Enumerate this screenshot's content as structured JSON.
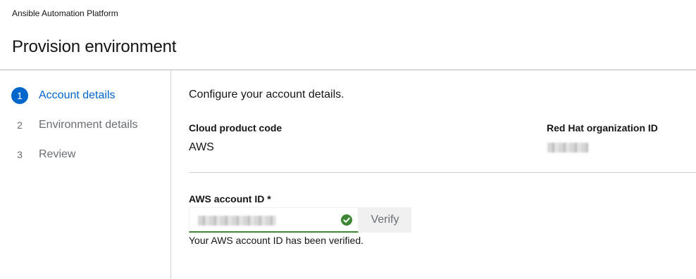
{
  "app": {
    "name": "Ansible Automation Platform"
  },
  "page": {
    "title": "Provision environment"
  },
  "wizard": {
    "steps": [
      {
        "number": "1",
        "label": "Account details",
        "current": true
      },
      {
        "number": "2",
        "label": "Environment details",
        "current": false
      },
      {
        "number": "3",
        "label": "Review",
        "current": false
      }
    ]
  },
  "main": {
    "section_title": "Configure your account details.",
    "cloud_product_code": {
      "label": "Cloud product code",
      "value": "AWS"
    },
    "org_id": {
      "label": "Red Hat organization ID"
    },
    "aws_account": {
      "label": "AWS account ID *",
      "verify_label": "Verify",
      "helper": "Your AWS account ID has been verified.",
      "status": "verified"
    }
  },
  "colors": {
    "primary": "#0066cc",
    "success": "#3e8635",
    "divider": "#d2d2d2"
  },
  "icons": {
    "verified": "check-circle-icon"
  }
}
